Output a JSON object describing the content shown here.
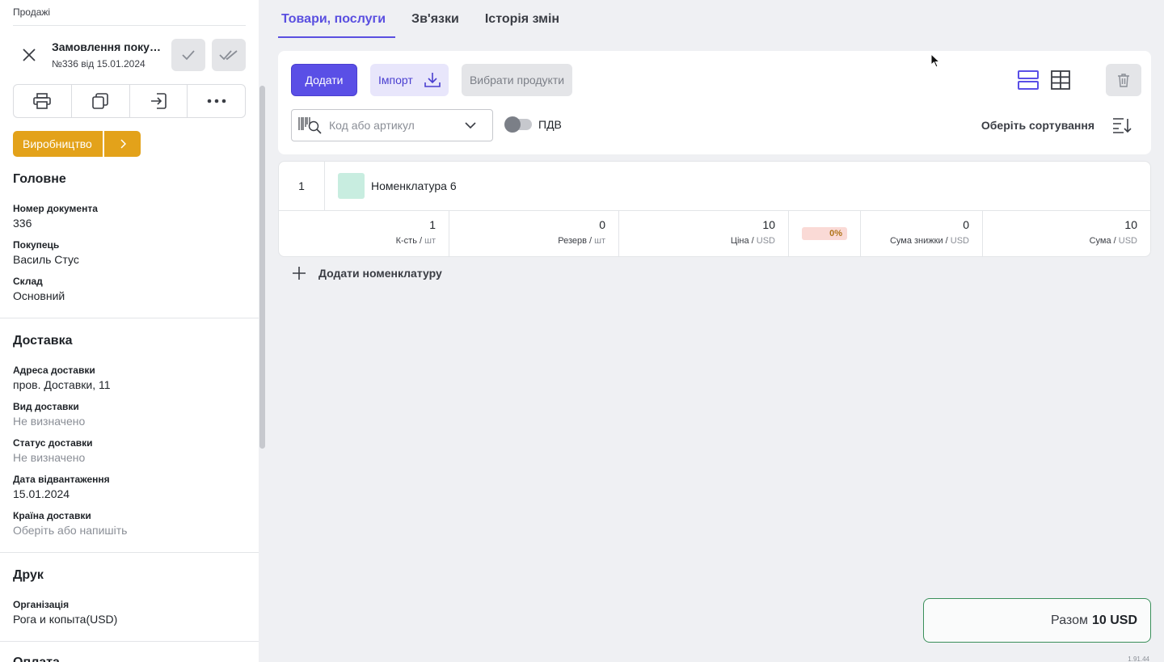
{
  "breadcrumb": "Продажі",
  "order": {
    "title": "Замовлення покуп...",
    "subtitle": "№336 від 15.01.2024"
  },
  "production_button": "Виробництво",
  "sections": {
    "main": {
      "title": "Головне",
      "fields": [
        {
          "label": "Номер документа",
          "value": "336"
        },
        {
          "label": "Покупець",
          "value": "Василь Стус"
        },
        {
          "label": "Склад",
          "value": "Основний"
        }
      ]
    },
    "delivery": {
      "title": "Доставка",
      "fields": [
        {
          "label": "Адреса доставки",
          "value": "пров. Доставки, 11"
        },
        {
          "label": "Вид доставки",
          "value": "Не визначено"
        },
        {
          "label": "Статус доставки",
          "value": "Не визначено"
        },
        {
          "label": "Дата відвантаження",
          "value": "15.01.2024"
        },
        {
          "label": "Країна доставки",
          "value": "Оберіть або напишіть"
        }
      ]
    },
    "print": {
      "title": "Друк",
      "fields": [
        {
          "label": "Організація",
          "value": "Рога и копыта(USD)"
        }
      ]
    },
    "payment": {
      "title": "Оплата"
    }
  },
  "tabs": [
    "Товари, послуги",
    "Зв'язки",
    "Історія змін"
  ],
  "toolbar": {
    "add_label": "Додати",
    "import_label": "Імпорт",
    "pick_label": "Вибрати продукти",
    "search_placeholder": "Код або артикул",
    "vat_label": "ПДВ",
    "sort_label": "Оберіть сортування"
  },
  "items": [
    {
      "index": "1",
      "name": "Номенклатура 6",
      "quantity": {
        "value": "1",
        "label": "К-сть",
        "unit": "шт"
      },
      "reserve": {
        "value": "0",
        "label": "Резерв",
        "unit": "шт"
      },
      "price": {
        "value": "10",
        "label": "Ціна",
        "unit": "USD"
      },
      "discount_percent": "0%",
      "discount_sum": {
        "value": "0",
        "label": "Сума знижки",
        "unit": "USD"
      },
      "sum": {
        "value": "10",
        "label": "Сума",
        "unit": "USD"
      }
    }
  ],
  "add_nomenclature_label": "Додати номенклатуру",
  "total": {
    "label": "Разом",
    "value": "10 USD"
  },
  "version": "1.91.44",
  "colors": {
    "accent": "#5a4fe6",
    "production": "#e3a21a",
    "total_border": "#3a8f5a"
  }
}
